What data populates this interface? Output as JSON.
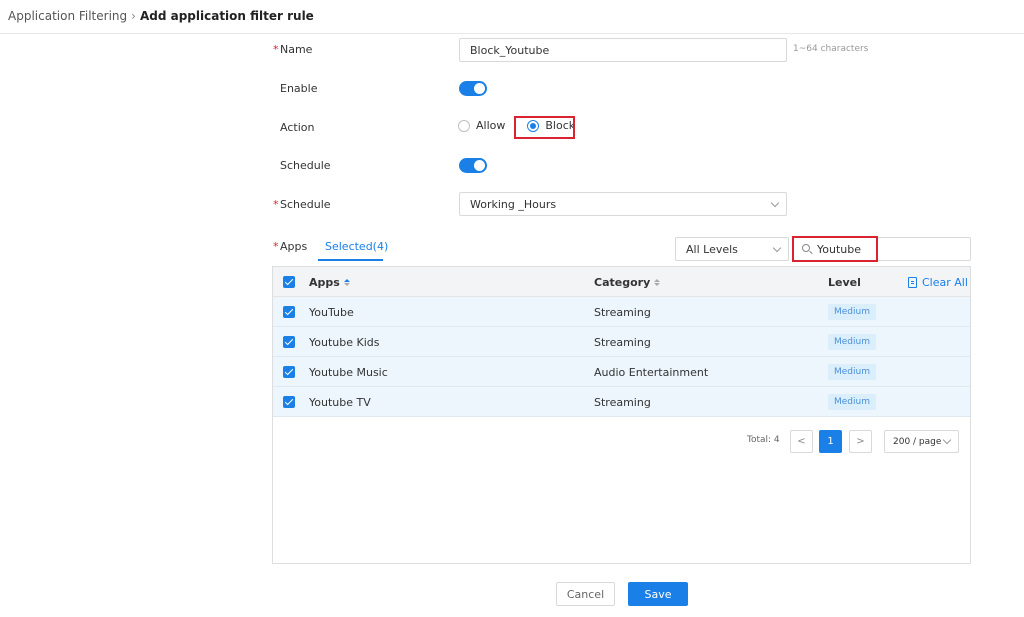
{
  "breadcrumb": {
    "parent": "Application Filtering",
    "separator": "›",
    "current": "Add application filter rule"
  },
  "form": {
    "name": {
      "label": "Name",
      "value": "Block_Youtube",
      "hint": "1~64 characters"
    },
    "enable": {
      "label": "Enable",
      "on": true
    },
    "action": {
      "label": "Action",
      "options": [
        "Allow",
        "Block"
      ],
      "selected": "Block"
    },
    "schedule_toggle": {
      "label": "Schedule",
      "on": true
    },
    "schedule_select": {
      "label": "Schedule",
      "value": "Working _Hours"
    },
    "required_mark": "*"
  },
  "apps": {
    "label": "Apps",
    "tab": "Selected(4)",
    "level_filter": "All Levels",
    "search_value": "Youtube",
    "columns": {
      "apps": "Apps",
      "category": "Category",
      "level": "Level"
    },
    "clear_all": "Clear All",
    "rows": [
      {
        "name": "YouTube",
        "category": "Streaming",
        "level": "Medium"
      },
      {
        "name": "Youtube Kids",
        "category": "Streaming",
        "level": "Medium"
      },
      {
        "name": "Youtube Music",
        "category": "Audio Entertainment",
        "level": "Medium"
      },
      {
        "name": "Youtube TV",
        "category": "Streaming",
        "level": "Medium"
      }
    ],
    "pagination": {
      "total": "Total: 4",
      "prev": "<",
      "current_page": "1",
      "next": ">",
      "page_size": "200 / page"
    }
  },
  "buttons": {
    "cancel": "Cancel",
    "save": "Save"
  },
  "colors": {
    "accent": "#1a7fe6",
    "highlight": "#d9232e"
  }
}
